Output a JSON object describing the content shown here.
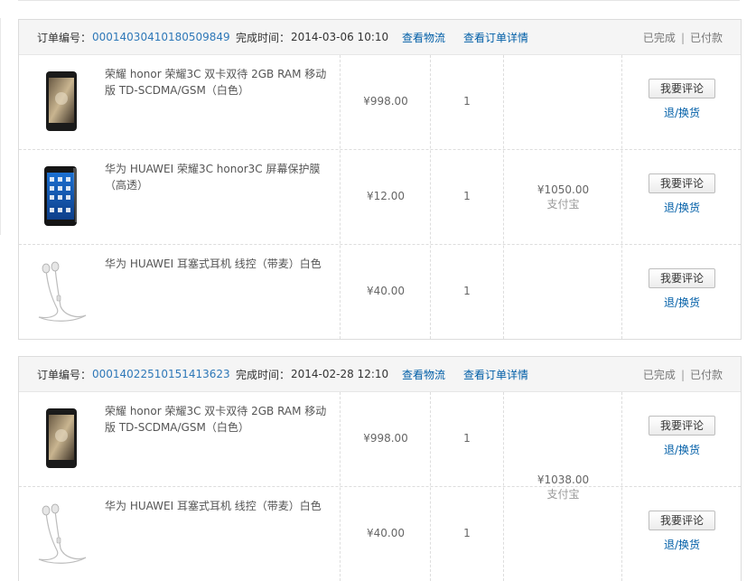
{
  "orders": [
    {
      "number_label": "订单编号：",
      "number": "00014030410180509849",
      "time_label": "完成时间：",
      "time": "2014-03-06 10:10",
      "logistics_link": "查看物流",
      "details_link": "查看订单详情",
      "status_completed": "已完成",
      "status_separator": "|",
      "status_paid": "已付款",
      "total": "¥1050.00",
      "payment_method": "支付宝",
      "items": [
        {
          "image": "phone-black-icon",
          "name": "荣耀 honor 荣耀3C 双卡双待 2GB RAM 移动版 TD-SCDMA/GSM（白色）",
          "price": "¥998.00",
          "qty": "1",
          "review_button": "我要评论",
          "return_link": "退/换货"
        },
        {
          "image": "phone-blue-screen-icon",
          "name": "华为 HUAWEI 荣耀3C honor3C 屏幕保护膜（高透）",
          "price": "¥12.00",
          "qty": "1",
          "review_button": "我要评论",
          "return_link": "退/换货"
        },
        {
          "image": "earphones-icon",
          "name": "华为 HUAWEI 耳塞式耳机 线控（带麦）白色",
          "price": "¥40.00",
          "qty": "1",
          "review_button": "我要评论",
          "return_link": "退/换货"
        }
      ]
    },
    {
      "number_label": "订单编号：",
      "number": "00014022510151413623",
      "time_label": "完成时间：",
      "time": "2014-02-28 12:10",
      "logistics_link": "查看物流",
      "details_link": "查看订单详情",
      "status_completed": "已完成",
      "status_separator": "|",
      "status_paid": "已付款",
      "total": "¥1038.00",
      "payment_method": "支付宝",
      "items": [
        {
          "image": "phone-black-icon",
          "name": "荣耀 honor 荣耀3C 双卡双待 2GB RAM 移动版 TD-SCDMA/GSM（白色）",
          "price": "¥998.00",
          "qty": "1",
          "review_button": "我要评论",
          "return_link": "退/换货"
        },
        {
          "image": "earphones-icon",
          "name": "华为 HUAWEI 耳塞式耳机 线控（带麦）白色",
          "price": "¥40.00",
          "qty": "1",
          "review_button": "我要评论",
          "return_link": "退/换货"
        }
      ]
    }
  ]
}
